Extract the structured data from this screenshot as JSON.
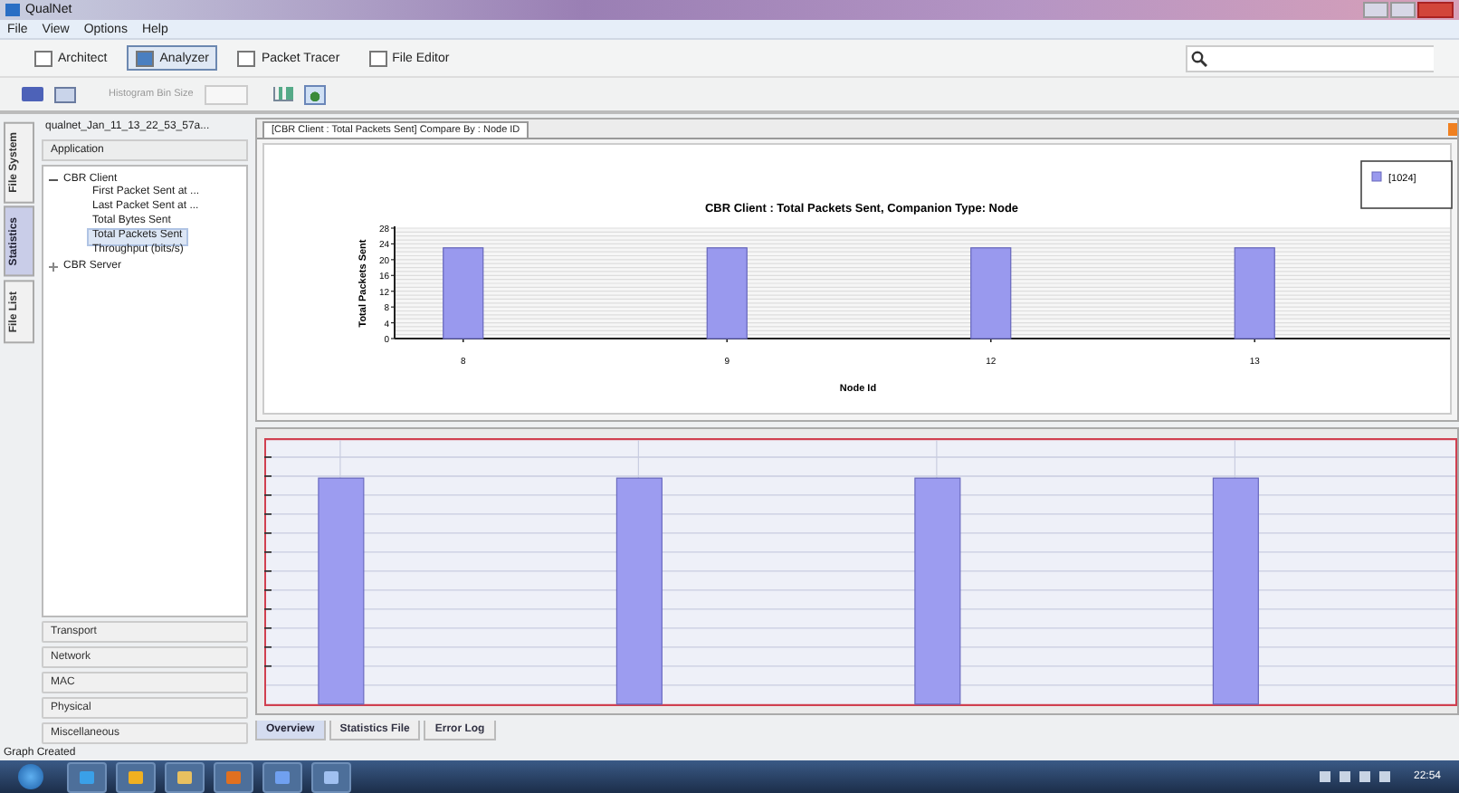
{
  "window": {
    "title": "QualNet"
  },
  "menu": [
    "File",
    "View",
    "Options",
    "Help"
  ],
  "modes": [
    {
      "label": "Architect",
      "selected": false
    },
    {
      "label": "Analyzer",
      "selected": true
    },
    {
      "label": "Packet Tracer",
      "selected": false
    },
    {
      "label": "File Editor",
      "selected": false
    }
  ],
  "toolbar": {
    "bin_size_label": "Histogram Bin Size",
    "disabled": true
  },
  "side_tabs": [
    {
      "label": "File System",
      "selected": false
    },
    {
      "label": "Statistics",
      "selected": true
    },
    {
      "label": "File List",
      "selected": false
    }
  ],
  "sidebar": {
    "file": "qualnet_Jan_11_13_22_53_57a...",
    "layer": "Application",
    "tree": [
      {
        "label": "CBR Client",
        "expanded": true,
        "selected": false,
        "children": [
          {
            "label": "First Packet Sent at ...",
            "selected": false
          },
          {
            "label": "Last Packet Sent at ...",
            "selected": false
          },
          {
            "label": "Total Bytes Sent",
            "selected": false
          },
          {
            "label": "Total Packets Sent",
            "selected": true
          },
          {
            "label": "Throughput (bits/s)",
            "selected": false
          }
        ]
      },
      {
        "label": "CBR Server",
        "expanded": false,
        "selected": false
      }
    ],
    "layers": [
      "Transport",
      "Network",
      "MAC",
      "Physical",
      "Miscellaneous"
    ]
  },
  "chart_tab": {
    "label": "[CBR Client : Total Packets Sent] Compare By : Node ID"
  },
  "chart": {
    "chart_data": {
      "type": "bar",
      "title": "CBR Client : Total Packets Sent, Companion Type: Node",
      "xlabel": "Node Id",
      "ylabel": "Total Packets Sent",
      "categories": [
        "8",
        "9",
        "12",
        "13"
      ],
      "series": [
        {
          "name": "[1024]",
          "color": "#9999ee",
          "values": [
            23,
            23,
            23,
            23
          ]
        }
      ],
      "grid": true,
      "ylim": [
        0,
        28
      ],
      "yticks": [
        0,
        4,
        8,
        12,
        16,
        20,
        24,
        28
      ]
    }
  },
  "bottom_tabs": [
    {
      "label": "Overview",
      "selected": true
    },
    {
      "label": "Statistics File",
      "selected": false
    },
    {
      "label": "Error Log",
      "selected": false
    }
  ],
  "status_bar": "Graph Created",
  "taskbar": {
    "clock": "22:54"
  }
}
